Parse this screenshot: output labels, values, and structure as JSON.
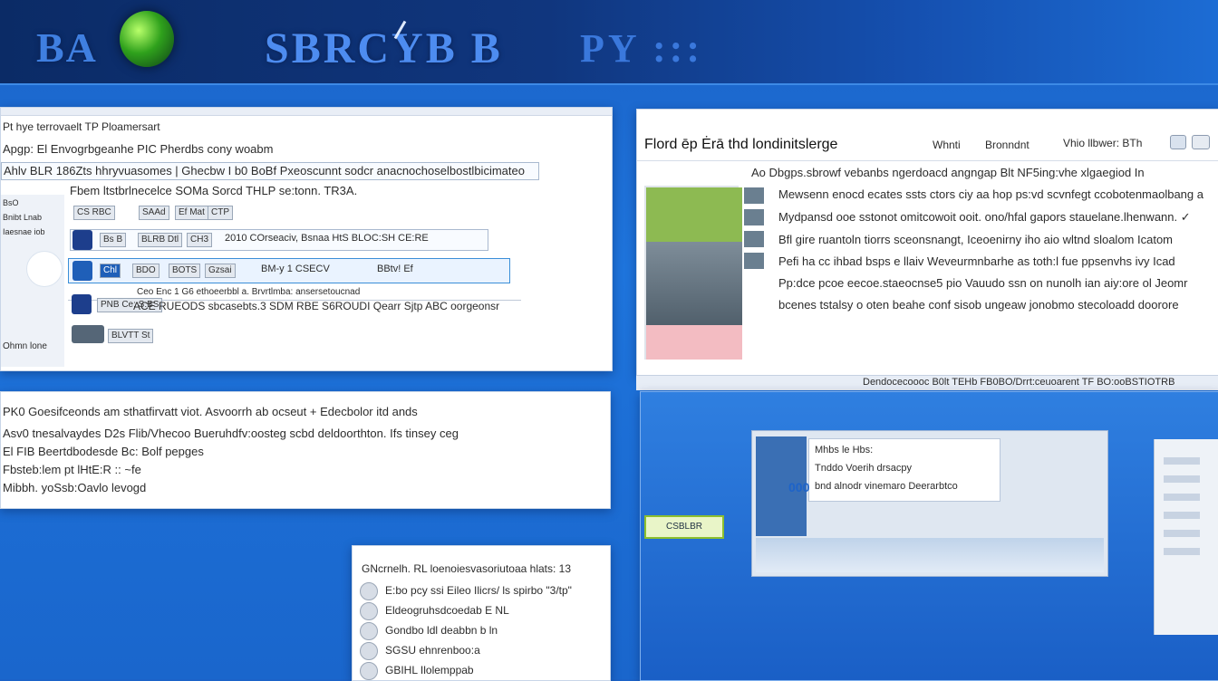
{
  "banner": {
    "brand": "BA",
    "title": "SBRCYB B",
    "tag": "PY :::",
    "accent": "#3f7fe0"
  },
  "w1": {
    "lines": [
      "Pt hye terrovaelt TP Ploamersart",
      "Apgp: El Envogrbgeanhe PIC Pherdbs cony woabm",
      "Ahlv BLR 186Zts hhryvuasomes | Ghecbw I b0 BoBf Pxeoscunnt sodcr anacnochoselbostlbicimateo",
      "Fbem ltstbrlnecelce SOMa Sorcd THLP se:tonn. TR3A.",
      "Ceo Enc 1 G6 ethoeerbbl a. Brvrtlmba: ansersetoucnad",
      "ACE RUEODS sbcasebts.3 SDM RBE S6ROUDI Qearr Sjtp ABC oorgeonsr"
    ],
    "row1": [
      "CS RBC",
      "SAAd",
      "Ef Mat",
      "CTP"
    ],
    "row2": [
      "Bs B",
      "BLRB Dtl",
      "CH3",
      "2010 COrseaciv, Bsnaa HtS BLOC:SH CE:RE"
    ],
    "row3": [
      "Chl",
      "BDO",
      "BOTS",
      "Gzsai",
      "BM-y 1 CSECV",
      "BBtv! Ef"
    ],
    "row4": [
      "PNB Ce: S:BS",
      "BLVTT St"
    ],
    "side_labels": [
      "BsO",
      "Bnibt Lnab",
      "Iaesnae iob",
      "Ohmn lone"
    ]
  },
  "w2": {
    "title": "Flord ēp Ėrā thd londinitslerge",
    "tabs": [
      "Whnti",
      "Bronndnt",
      "Vhio llbwer: BTh"
    ],
    "tab_icons": [
      "close-icon",
      "grid-icon"
    ],
    "body": [
      "Ao Dbgps.sbrowf vebanbs ngerdoacd angngap Blt NF5ing:vhe xlgaegiod In",
      "Mewsenn enocd ecates ssts ctors ciy aa hop ps:vd scvnfegt ccobotenmaolbang a",
      "Mydpansd ooe sstonot omitcowoit ooit. ono/hfal gapors stauelane.lhenwann. ✓",
      "Bfl gire ruantoln tiorrs sceonsnangt, Iceoenirny iho aio wltnd sloalom Icatom",
      "Pefi ha cc ihbad bsps e llaiv Weveurmnbarhe as toth:l fue ppsenvhs ivy Icad",
      "Pp:dce pcoe eecoe.staeocnse5 pio Vauudo ssn on nunolh ian aiy:ore ol Jeomr",
      "bcenes tstalsy o oten beahe conf sisob ungeaw jonobmo stecoloadd doorore"
    ],
    "status": "Dendocecoooc B0lt TEHb FB0BO/Drrt:ceuoarent TF BO:ooBSTIOTRB"
  },
  "w3": {
    "lines": [
      "PK0 Goesifceonds am sthatfirvatt viot. Asvoorrh ab ocseut + Edecbolor itd ands",
      "Asv0 tnesalvaydes D2s Flib/Vhecoo Bueruhdfv:oosteg scbd deldoorthton. Ifs tinsey ceg",
      "El FIB Beertdbodesde Bc: Bolf pepges",
      "Fbsteb:lem pt lHtE:R :: ~fe",
      "Mibbh. yoSsb:Oavlo levogd"
    ]
  },
  "w4": {
    "items": [
      "GNcrnelh. RL loenoiesvasoriutoaa hlats:  13",
      "E:bo pcy ssi Eileo Ilicrs/ ls spirbo \"3/tp\"",
      "Eldeogruhsdcoedab E NL",
      "Gondbo ldl deabbn b ln",
      "SGSU ehnrenboo:a",
      "GBIHL Ilolemppab"
    ]
  },
  "w5": {
    "panel_lines": [
      "Mhbs le Hbs:",
      "Tnddo Voerih drsacpy",
      "bnd alnodr vinemaro Deerarbtco"
    ],
    "number": "000",
    "chip": "CSBLBR",
    "accent": "#8cbf2e"
  }
}
